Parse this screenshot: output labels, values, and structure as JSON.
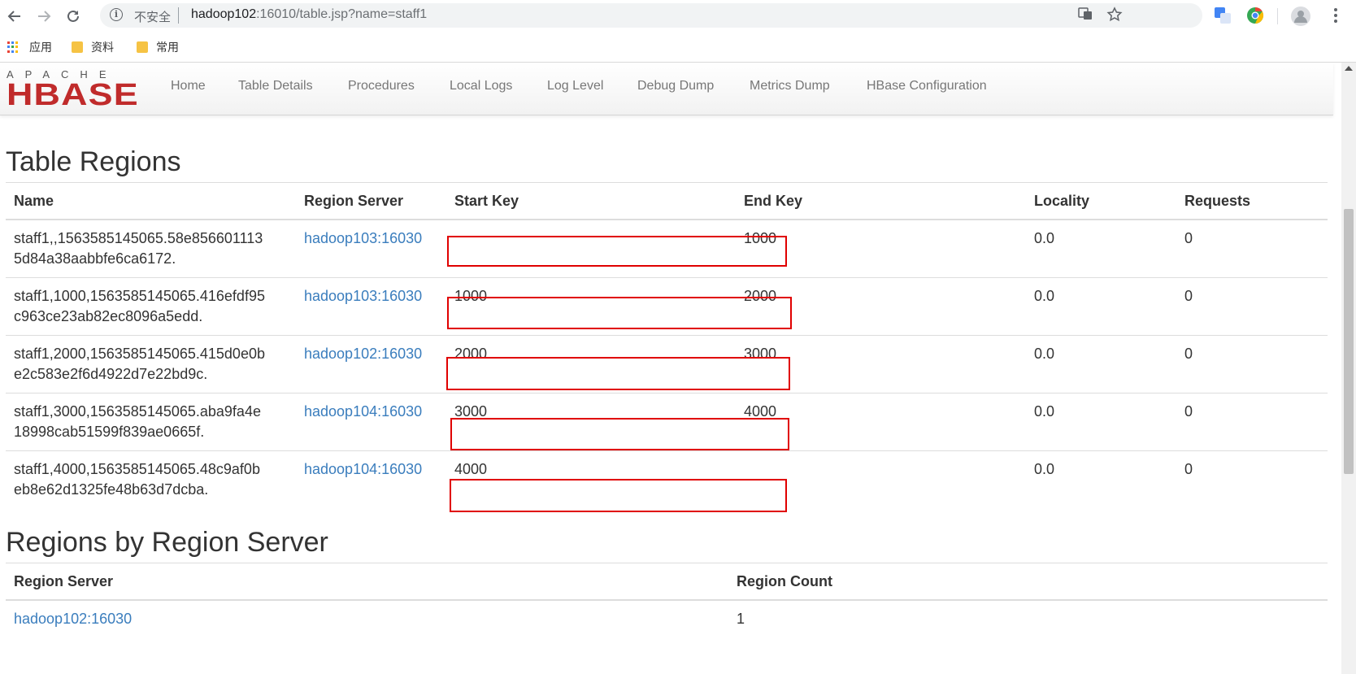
{
  "browser": {
    "insecure_label": "不安全",
    "url_host": "hadoop102",
    "url_rest": ":16010/table.jsp?name=staff1",
    "bookmarks": [
      {
        "label": "应用",
        "icon": "apps-grid-icon"
      },
      {
        "label": "资料",
        "icon": "folder-icon"
      },
      {
        "label": "常用",
        "icon": "folder-icon"
      }
    ]
  },
  "hbase": {
    "logo_top": "APACHE",
    "logo_main": "HBASE",
    "nav": [
      "Home",
      "Table Details",
      "Procedures",
      "Local Logs",
      "Log Level",
      "Debug Dump",
      "Metrics Dump",
      "HBase Configuration"
    ]
  },
  "table_regions": {
    "title": "Table Regions",
    "headers": [
      "Name",
      "Region Server",
      "Start Key",
      "End Key",
      "Locality",
      "Requests"
    ],
    "rows": [
      {
        "name_line1": "staff1,,1563585145065.58e856601113",
        "name_line2": "5d84a38aabbfe6ca6172.",
        "server": "hadoop103:16030",
        "start_key": "",
        "end_key": "1000",
        "locality": "0.0",
        "requests": "0"
      },
      {
        "name_line1": "staff1,1000,1563585145065.416efdf95",
        "name_line2": "c963ce23ab82ec8096a5edd.",
        "server": "hadoop103:16030",
        "start_key": "1000",
        "end_key": "2000",
        "locality": "0.0",
        "requests": "0"
      },
      {
        "name_line1": "staff1,2000,1563585145065.415d0e0b",
        "name_line2": "e2c583e2f6d4922d7e22bd9c.",
        "server": "hadoop102:16030",
        "start_key": "2000",
        "end_key": "3000",
        "locality": "0.0",
        "requests": "0"
      },
      {
        "name_line1": "staff1,3000,1563585145065.aba9fa4e",
        "name_line2": "18998cab51599f839ae0665f.",
        "server": "hadoop104:16030",
        "start_key": "3000",
        "end_key": "4000",
        "locality": "0.0",
        "requests": "0"
      },
      {
        "name_line1": "staff1,4000,1563585145065.48c9af0b",
        "name_line2": "eb8e62d1325fe48b63d7dcba.",
        "server": "hadoop104:16030",
        "start_key": "4000",
        "end_key": "",
        "locality": "0.0",
        "requests": "0"
      }
    ]
  },
  "regions_by_server": {
    "title": "Regions by Region Server",
    "headers": [
      "Region Server",
      "Region Count"
    ],
    "rows": [
      {
        "server": "hadoop102:16030",
        "count": "1"
      }
    ]
  },
  "colors": {
    "link": "#3a7dbd",
    "highlight": "#e00000",
    "hbase_red": "#c02b2b"
  }
}
